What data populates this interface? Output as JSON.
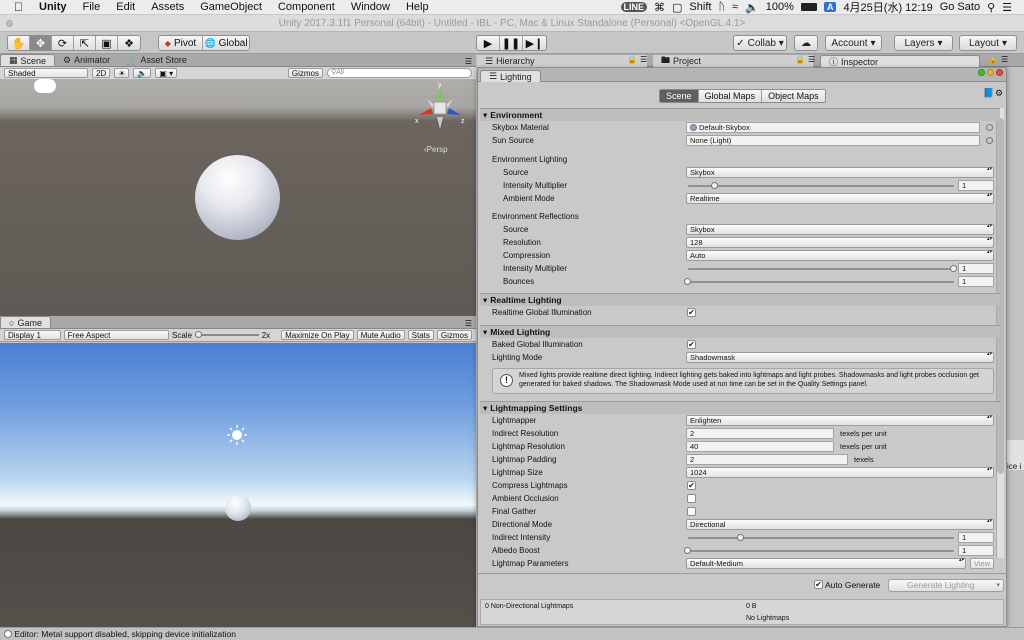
{
  "menubar": {
    "app_name": "Unity",
    "items": [
      "File",
      "Edit",
      "Assets",
      "GameObject",
      "Component",
      "Window",
      "Help"
    ],
    "status": {
      "line_badge": "LINE",
      "shift": "Shift",
      "battery": "100%",
      "input_badge": "A",
      "datetime": "4月25日(水) 12:19",
      "user": "Go Sato"
    }
  },
  "titlebar": {
    "title": "Unity 2017.3.1f1 Personal (64bit) - Untitled - IBL - PC, Mac & Linux Standalone (Personal) <OpenGL 4.1>"
  },
  "toolbar": {
    "pivot": "Pivot",
    "global": "Global",
    "collab": "Collab ▾",
    "account": "Account",
    "layers": "Layers",
    "layout": "Layout"
  },
  "scene_panel": {
    "tabs": [
      "Scene",
      "Animator",
      "Asset Store"
    ],
    "shading": "Shaded",
    "mode_2d": "2D",
    "gizmos": "Gizmos",
    "search_placeholder": "All",
    "persp_label": "‹Persp"
  },
  "game_panel": {
    "tab": "Game",
    "display": "Display 1",
    "aspect": "Free Aspect",
    "scale_label": "Scale",
    "scale_value": "2x",
    "maximize": "Maximize On Play",
    "mute": "Mute Audio",
    "stats": "Stats",
    "gizmos": "Gizmos"
  },
  "right_tabs": {
    "hierarchy": "Hierarchy",
    "project": "Project",
    "inspector": "Inspector",
    "lighting": "Lighting"
  },
  "lighting": {
    "tabs": [
      "Scene",
      "Global Maps",
      "Object Maps"
    ],
    "environment": {
      "header": "Environment",
      "skybox_label": "Skybox Material",
      "skybox_value": "Default-Skybox",
      "sun_label": "Sun Source",
      "sun_value": "None (Light)",
      "env_lighting": "Environment Lighting",
      "source_label": "Source",
      "source_value": "Skybox",
      "intensity_label": "Intensity Multiplier",
      "intensity_value": "1",
      "intensity_frac": 0.1,
      "ambient_label": "Ambient Mode",
      "ambient_value": "Realtime",
      "env_reflections": "Environment Reflections",
      "ref_source_label": "Source",
      "ref_source_value": "Skybox",
      "resolution_label": "Resolution",
      "resolution_value": "128",
      "compression_label": "Compression",
      "compression_value": "Auto",
      "ref_intensity_label": "Intensity Multiplier",
      "ref_intensity_value": "1",
      "ref_intensity_frac": 1.0,
      "bounces_label": "Bounces",
      "bounces_value": "1",
      "bounces_frac": 0.0
    },
    "realtime": {
      "header": "Realtime Lighting",
      "rgi_label": "Realtime Global Illumination",
      "rgi_checked": true
    },
    "mixed": {
      "header": "Mixed Lighting",
      "bgi_label": "Baked Global Illumination",
      "bgi_checked": true,
      "mode_label": "Lighting Mode",
      "mode_value": "Shadowmask",
      "info": "Mixed lights provide realtime direct lighting. Indirect lighting gets baked into lightmaps and light probes. Shadowmasks and light probes occlusion get generated for baked shadows. The Shadowmask Mode used at run time can be set in the Quality Settings panel."
    },
    "lightmapping": {
      "header": "Lightmapping Settings",
      "lightmapper_label": "Lightmapper",
      "lightmapper_value": "Enlighten",
      "indirect_res_label": "Indirect Resolution",
      "indirect_res_value": "2",
      "indirect_res_unit": "texels per unit",
      "lightmap_res_label": "Lightmap Resolution",
      "lightmap_res_value": "40",
      "lightmap_res_unit": "texels per unit",
      "padding_label": "Lightmap Padding",
      "padding_value": "2",
      "padding_unit": "texels",
      "size_label": "Lightmap Size",
      "size_value": "1024",
      "compress_label": "Compress Lightmaps",
      "compress_checked": true,
      "ao_label": "Ambient Occlusion",
      "ao_checked": false,
      "fg_label": "Final Gather",
      "fg_checked": false,
      "dir_label": "Directional Mode",
      "dir_value": "Directional",
      "ind_int_label": "Indirect Intensity",
      "ind_int_value": "1",
      "ind_int_frac": 0.2,
      "albedo_label": "Albedo Boost",
      "albedo_value": "1",
      "albedo_frac": 0.0,
      "params_label": "Lightmap Parameters",
      "params_value": "Default-Medium",
      "view_label": "View"
    },
    "auto_generate_label": "Auto Generate",
    "auto_generate_checked": true,
    "generate_label": "Generate Lighting",
    "footer": {
      "left": "0 Non-Directional Lightmaps",
      "size": "0 B",
      "note": "No Lightmaps"
    }
  },
  "statusbar": {
    "text": "Editor: Metal support disabled, skipping device initialization"
  },
  "clipped_text": "ice i"
}
